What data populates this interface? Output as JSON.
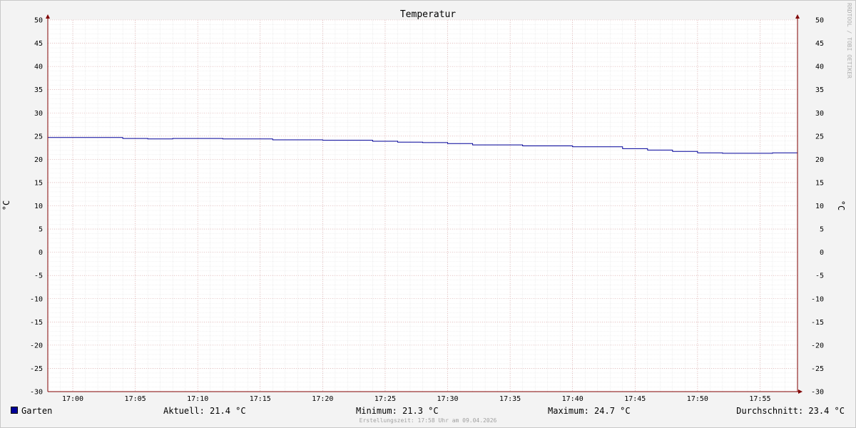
{
  "chart_data": {
    "type": "line",
    "title": "Temperatur",
    "ylabel": "°C",
    "ylim": [
      -30,
      50
    ],
    "yticks": [
      50,
      45,
      40,
      35,
      30,
      25,
      20,
      15,
      10,
      5,
      0,
      -5,
      -10,
      -15,
      -20,
      -25,
      -30
    ],
    "xlim": [
      "16:58",
      "17:58"
    ],
    "xtick_labels": [
      "17:00",
      "17:05",
      "17:10",
      "17:15",
      "17:20",
      "17:25",
      "17:30",
      "17:35",
      "17:40",
      "17:45",
      "17:50",
      "17:55"
    ],
    "grid": true,
    "series": [
      {
        "name": "Garten",
        "color": "#000099",
        "x": [
          "16:58",
          "17:04",
          "17:06",
          "17:08",
          "17:12",
          "17:16",
          "17:20",
          "17:24",
          "17:26",
          "17:28",
          "17:30",
          "17:32",
          "17:36",
          "17:40",
          "17:44",
          "17:46",
          "17:48",
          "17:50",
          "17:52",
          "17:56",
          "17:58"
        ],
        "y": [
          24.7,
          24.5,
          24.4,
          24.5,
          24.4,
          24.2,
          24.1,
          23.9,
          23.7,
          23.6,
          23.4,
          23.1,
          22.9,
          22.7,
          22.3,
          22.0,
          21.7,
          21.4,
          21.3,
          21.4,
          21.4
        ]
      }
    ],
    "legend": "bottom",
    "stats": {
      "current": "Aktuell: 21.4 °C",
      "min": "Minimum: 21.3 °C",
      "max": "Maximum: 24.7 °C",
      "avg": "Durchschnitt: 23.4 °C"
    }
  },
  "watermark": "RRDTOOL / TOBI OETIKER",
  "created": "Erstellungszeit: 17:58 Uhr am 09.04.2026"
}
